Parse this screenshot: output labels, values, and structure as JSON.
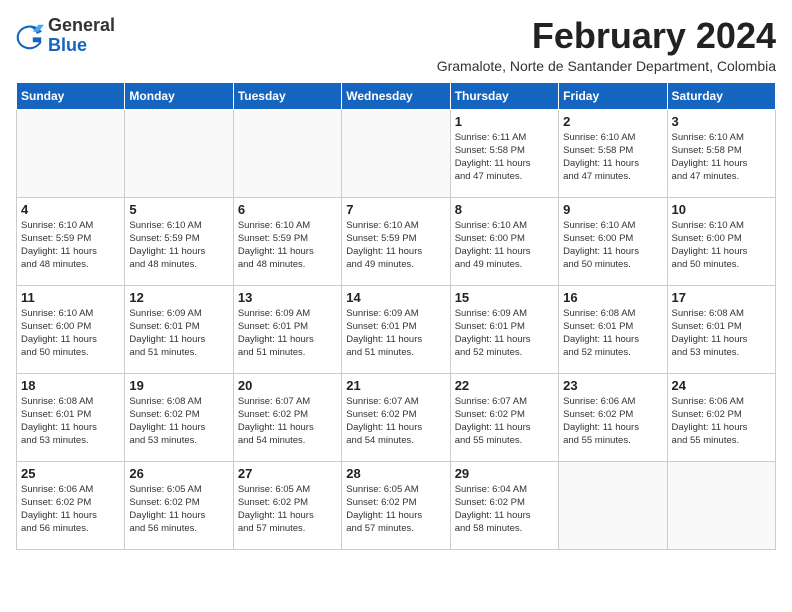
{
  "logo": {
    "general": "General",
    "blue": "Blue"
  },
  "title": {
    "month_year": "February 2024",
    "location": "Gramalote, Norte de Santander Department, Colombia"
  },
  "days_of_week": [
    "Sunday",
    "Monday",
    "Tuesday",
    "Wednesday",
    "Thursday",
    "Friday",
    "Saturday"
  ],
  "weeks": [
    [
      {
        "day": "",
        "info": ""
      },
      {
        "day": "",
        "info": ""
      },
      {
        "day": "",
        "info": ""
      },
      {
        "day": "",
        "info": ""
      },
      {
        "day": "1",
        "info": "Sunrise: 6:11 AM\nSunset: 5:58 PM\nDaylight: 11 hours\nand 47 minutes."
      },
      {
        "day": "2",
        "info": "Sunrise: 6:10 AM\nSunset: 5:58 PM\nDaylight: 11 hours\nand 47 minutes."
      },
      {
        "day": "3",
        "info": "Sunrise: 6:10 AM\nSunset: 5:58 PM\nDaylight: 11 hours\nand 47 minutes."
      }
    ],
    [
      {
        "day": "4",
        "info": "Sunrise: 6:10 AM\nSunset: 5:59 PM\nDaylight: 11 hours\nand 48 minutes."
      },
      {
        "day": "5",
        "info": "Sunrise: 6:10 AM\nSunset: 5:59 PM\nDaylight: 11 hours\nand 48 minutes."
      },
      {
        "day": "6",
        "info": "Sunrise: 6:10 AM\nSunset: 5:59 PM\nDaylight: 11 hours\nand 48 minutes."
      },
      {
        "day": "7",
        "info": "Sunrise: 6:10 AM\nSunset: 5:59 PM\nDaylight: 11 hours\nand 49 minutes."
      },
      {
        "day": "8",
        "info": "Sunrise: 6:10 AM\nSunset: 6:00 PM\nDaylight: 11 hours\nand 49 minutes."
      },
      {
        "day": "9",
        "info": "Sunrise: 6:10 AM\nSunset: 6:00 PM\nDaylight: 11 hours\nand 50 minutes."
      },
      {
        "day": "10",
        "info": "Sunrise: 6:10 AM\nSunset: 6:00 PM\nDaylight: 11 hours\nand 50 minutes."
      }
    ],
    [
      {
        "day": "11",
        "info": "Sunrise: 6:10 AM\nSunset: 6:00 PM\nDaylight: 11 hours\nand 50 minutes."
      },
      {
        "day": "12",
        "info": "Sunrise: 6:09 AM\nSunset: 6:01 PM\nDaylight: 11 hours\nand 51 minutes."
      },
      {
        "day": "13",
        "info": "Sunrise: 6:09 AM\nSunset: 6:01 PM\nDaylight: 11 hours\nand 51 minutes."
      },
      {
        "day": "14",
        "info": "Sunrise: 6:09 AM\nSunset: 6:01 PM\nDaylight: 11 hours\nand 51 minutes."
      },
      {
        "day": "15",
        "info": "Sunrise: 6:09 AM\nSunset: 6:01 PM\nDaylight: 11 hours\nand 52 minutes."
      },
      {
        "day": "16",
        "info": "Sunrise: 6:08 AM\nSunset: 6:01 PM\nDaylight: 11 hours\nand 52 minutes."
      },
      {
        "day": "17",
        "info": "Sunrise: 6:08 AM\nSunset: 6:01 PM\nDaylight: 11 hours\nand 53 minutes."
      }
    ],
    [
      {
        "day": "18",
        "info": "Sunrise: 6:08 AM\nSunset: 6:01 PM\nDaylight: 11 hours\nand 53 minutes."
      },
      {
        "day": "19",
        "info": "Sunrise: 6:08 AM\nSunset: 6:02 PM\nDaylight: 11 hours\nand 53 minutes."
      },
      {
        "day": "20",
        "info": "Sunrise: 6:07 AM\nSunset: 6:02 PM\nDaylight: 11 hours\nand 54 minutes."
      },
      {
        "day": "21",
        "info": "Sunrise: 6:07 AM\nSunset: 6:02 PM\nDaylight: 11 hours\nand 54 minutes."
      },
      {
        "day": "22",
        "info": "Sunrise: 6:07 AM\nSunset: 6:02 PM\nDaylight: 11 hours\nand 55 minutes."
      },
      {
        "day": "23",
        "info": "Sunrise: 6:06 AM\nSunset: 6:02 PM\nDaylight: 11 hours\nand 55 minutes."
      },
      {
        "day": "24",
        "info": "Sunrise: 6:06 AM\nSunset: 6:02 PM\nDaylight: 11 hours\nand 55 minutes."
      }
    ],
    [
      {
        "day": "25",
        "info": "Sunrise: 6:06 AM\nSunset: 6:02 PM\nDaylight: 11 hours\nand 56 minutes."
      },
      {
        "day": "26",
        "info": "Sunrise: 6:05 AM\nSunset: 6:02 PM\nDaylight: 11 hours\nand 56 minutes."
      },
      {
        "day": "27",
        "info": "Sunrise: 6:05 AM\nSunset: 6:02 PM\nDaylight: 11 hours\nand 57 minutes."
      },
      {
        "day": "28",
        "info": "Sunrise: 6:05 AM\nSunset: 6:02 PM\nDaylight: 11 hours\nand 57 minutes."
      },
      {
        "day": "29",
        "info": "Sunrise: 6:04 AM\nSunset: 6:02 PM\nDaylight: 11 hours\nand 58 minutes."
      },
      {
        "day": "",
        "info": ""
      },
      {
        "day": "",
        "info": ""
      }
    ]
  ]
}
